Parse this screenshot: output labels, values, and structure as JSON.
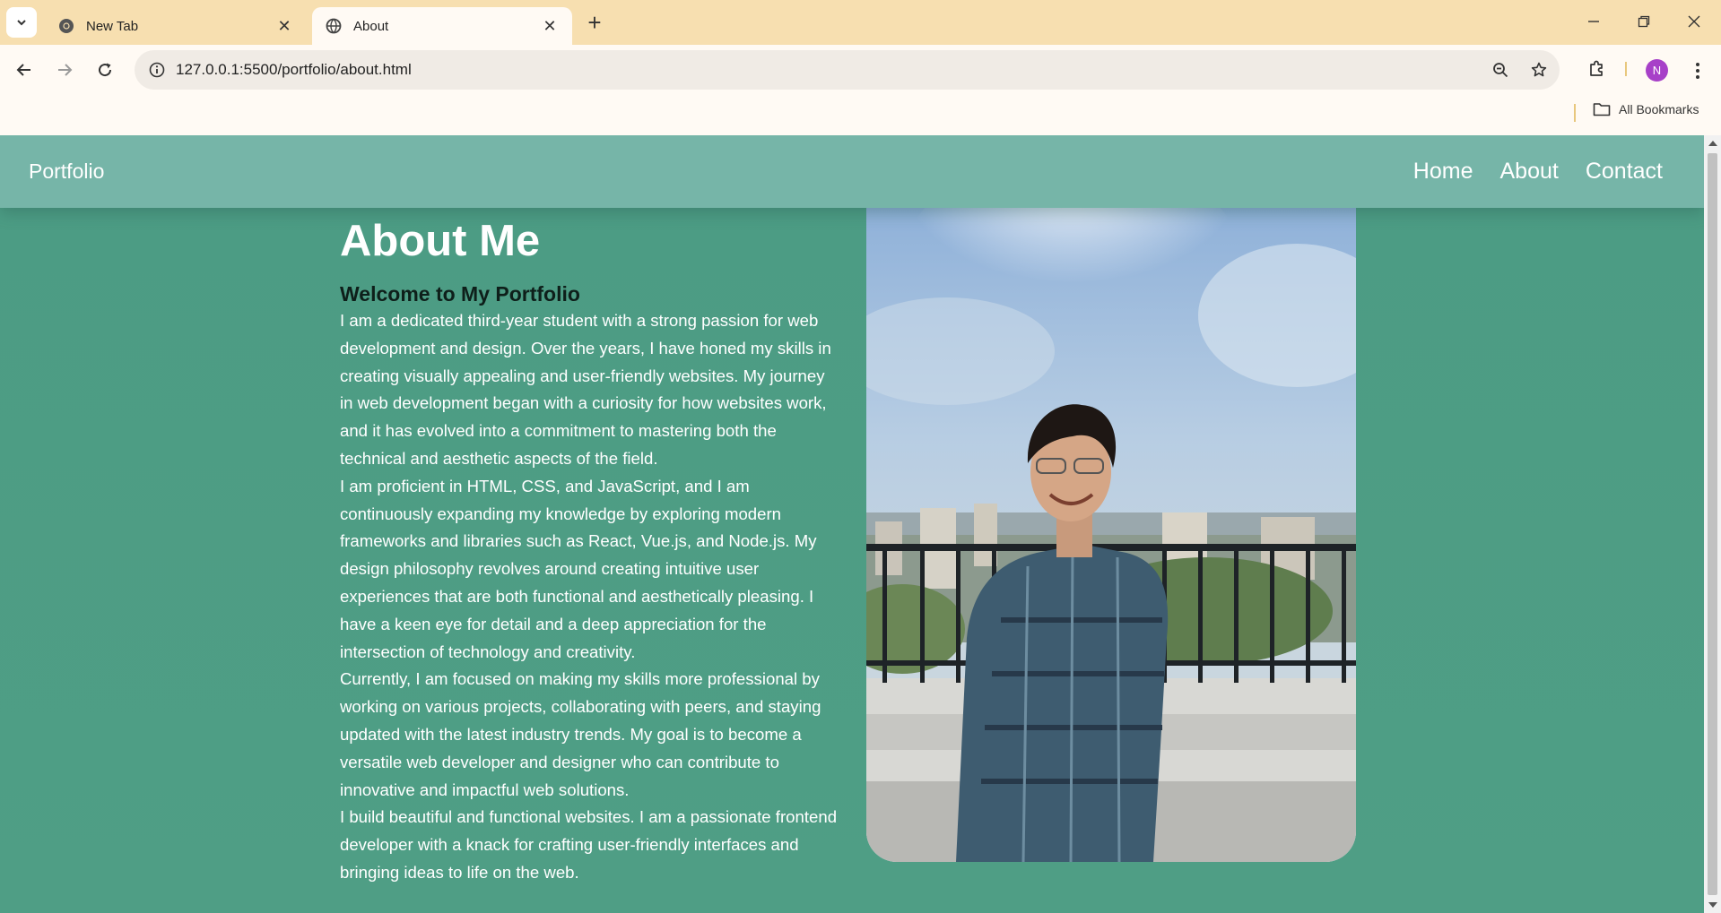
{
  "browser": {
    "tabs": [
      {
        "title": "New Tab",
        "icon": "chrome-icon",
        "active": false
      },
      {
        "title": "About",
        "icon": "globe-icon",
        "active": true
      }
    ],
    "address_bar": {
      "url": "127.0.0.1:5500/portfolio/about.html"
    },
    "profile_initial": "N",
    "bookmarks_label": "All Bookmarks",
    "colors": {
      "tabstrip": "#f7dfb0",
      "toolbar": "#fffaf4",
      "avatar": "#a740c8"
    }
  },
  "site": {
    "brand": "Portfolio",
    "nav": [
      "Home",
      "About",
      "Contact"
    ],
    "colors": {
      "background": "#4e9e84",
      "navbar": "#76b5a8",
      "subheading": "#0e1f1a"
    }
  },
  "about": {
    "heading": "About Me",
    "subheading": "Welcome to My Portfolio",
    "paragraphs": [
      "I am a dedicated third-year student with a strong passion for web development and design. Over the years, I have honed my skills in creating visually appealing and user-friendly websites. My journey in web development began with a curiosity for how websites work, and it has evolved into a commitment to mastering both the technical and aesthetic aspects of the field.",
      "I am proficient in HTML, CSS, and JavaScript, and I am continuously expanding my knowledge by exploring modern frameworks and libraries such as React, Vue.js, and Node.js. My design philosophy revolves around creating intuitive user experiences that are both functional and aesthetically pleasing. I have a keen eye for detail and a deep appreciation for the intersection of technology and creativity.",
      "Currently, I am focused on making my skills more professional by working on various projects, collaborating with peers, and staying updated with the latest industry trends. My goal is to become a versatile web developer and designer who can contribute to innovative and impactful web solutions.",
      "I build beautiful and functional websites. I am a passionate frontend developer with a knack for crafting user-friendly interfaces and bringing ideas to life on the web."
    ]
  }
}
